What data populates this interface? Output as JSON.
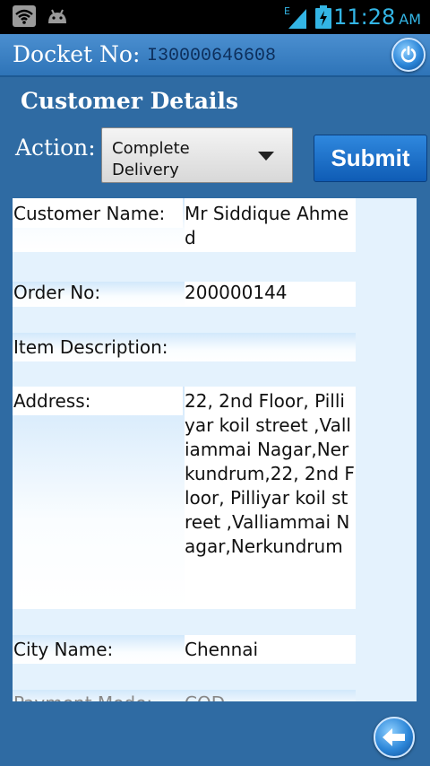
{
  "status_bar": {
    "time": "11:28",
    "ampm": "AM",
    "network_type": "E",
    "icons": [
      "wifi-icon",
      "android-debug-icon",
      "signal-icon",
      "battery-charging-icon"
    ],
    "accent_color": "#33b5e5"
  },
  "header": {
    "docket_label": "Docket No:",
    "docket_number": "I30000646608",
    "power_icon": "power-icon"
  },
  "section_title": "Customer Details",
  "action": {
    "label": "Action:",
    "selected": "Complete Delivery",
    "submit_label": "Submit"
  },
  "details": {
    "customer_name": {
      "label": "Customer Name:",
      "value": "Mr Siddique Ahmed"
    },
    "order_no": {
      "label": "Order No:",
      "value": "200000144"
    },
    "item_description": {
      "label": "Item Description:",
      "value": ""
    },
    "address": {
      "label": "Address:",
      "value": "22, 2nd Floor, Pilliyar koil street ,Valliammai Nagar,Nerkundrum,22, 2nd Floor, Pilliyar koil street ,Valliammai Nagar,Nerkundrum"
    },
    "city_name": {
      "label": "City Name:",
      "value": "Chennai"
    },
    "payment_mode": {
      "label": "Payment Mode:",
      "value": "COD"
    }
  },
  "footer": {
    "back_icon": "back-arrow-icon"
  },
  "colors": {
    "background": "#2f6ba3",
    "header": "#3a82c6",
    "panel": "#e4f2fd",
    "button": "#1a6fc8"
  }
}
